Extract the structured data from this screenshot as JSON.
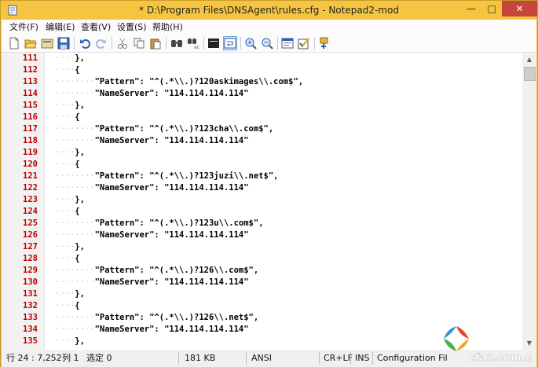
{
  "window": {
    "title": "* D:\\Program Files\\DNSAgent\\rules.cfg - Notepad2-mod",
    "buttons": {
      "minimize": "—",
      "maximize": "□",
      "close": "✕"
    }
  },
  "menu": [
    "文件(F)",
    "编辑(E)",
    "查看(V)",
    "设置(S)",
    "帮助(H)"
  ],
  "toolbar_icons": [
    "new-icon",
    "open-icon",
    "browse-icon",
    "save-icon",
    "undo-icon",
    "redo-icon",
    "cut-icon",
    "copy-icon",
    "paste-icon",
    "find-icon",
    "replace-icon",
    "word-wrap-icon",
    "view-whitespace-icon",
    "zoom-in-icon",
    "zoom-out-icon",
    "scheme-icon",
    "customize-icon",
    "launch-icon"
  ],
  "editor": {
    "lines": [
      {
        "no": "111",
        "indent": "····",
        "text": "},"
      },
      {
        "no": "112",
        "indent": "····",
        "text": "{"
      },
      {
        "no": "113",
        "indent": "········",
        "text": "\"Pattern\": \"^(.*\\\\.)?120askimages\\\\.com$\","
      },
      {
        "no": "114",
        "indent": "········",
        "text": "\"NameServer\": \"114.114.114.114\""
      },
      {
        "no": "115",
        "indent": "····",
        "text": "},"
      },
      {
        "no": "116",
        "indent": "····",
        "text": "{"
      },
      {
        "no": "117",
        "indent": "········",
        "text": "\"Pattern\": \"^(.*\\\\.)?123cha\\\\.com$\","
      },
      {
        "no": "118",
        "indent": "········",
        "text": "\"NameServer\": \"114.114.114.114\""
      },
      {
        "no": "119",
        "indent": "····",
        "text": "},"
      },
      {
        "no": "120",
        "indent": "····",
        "text": "{"
      },
      {
        "no": "121",
        "indent": "········",
        "text": "\"Pattern\": \"^(.*\\\\.)?123juzi\\\\.net$\","
      },
      {
        "no": "122",
        "indent": "········",
        "text": "\"NameServer\": \"114.114.114.114\""
      },
      {
        "no": "123",
        "indent": "····",
        "text": "},"
      },
      {
        "no": "124",
        "indent": "····",
        "text": "{"
      },
      {
        "no": "125",
        "indent": "········",
        "text": "\"Pattern\": \"^(.*\\\\.)?123u\\\\.com$\","
      },
      {
        "no": "126",
        "indent": "········",
        "text": "\"NameServer\": \"114.114.114.114\""
      },
      {
        "no": "127",
        "indent": "····",
        "text": "},"
      },
      {
        "no": "128",
        "indent": "····",
        "text": "{"
      },
      {
        "no": "129",
        "indent": "········",
        "text": "\"Pattern\": \"^(.*\\\\.)?126\\\\.com$\","
      },
      {
        "no": "130",
        "indent": "········",
        "text": "\"NameServer\": \"114.114.114.114\""
      },
      {
        "no": "131",
        "indent": "····",
        "text": "},"
      },
      {
        "no": "132",
        "indent": "····",
        "text": "{"
      },
      {
        "no": "133",
        "indent": "········",
        "text": "\"Pattern\": \"^(.*\\\\.)?126\\\\.net$\","
      },
      {
        "no": "134",
        "indent": "········",
        "text": "\"NameServer\": \"114.114.114.114\""
      },
      {
        "no": "135",
        "indent": "····",
        "text": "},"
      }
    ]
  },
  "status": {
    "position": "行 24 : 7,252",
    "column": "列 1",
    "selection": "选定 0",
    "size": "181 KB",
    "encoding": "ANSI",
    "line_ending": "CR+LF",
    "insert_mode": "INS",
    "scheme": "Configuration Fil"
  },
  "watermark": {
    "text": "cfan.com.cn"
  },
  "colors": {
    "titlebar": "#f5c542",
    "close_button": "#c7463a",
    "line_number": "#c00000",
    "whitespace_dot": "#c9c9c9"
  }
}
